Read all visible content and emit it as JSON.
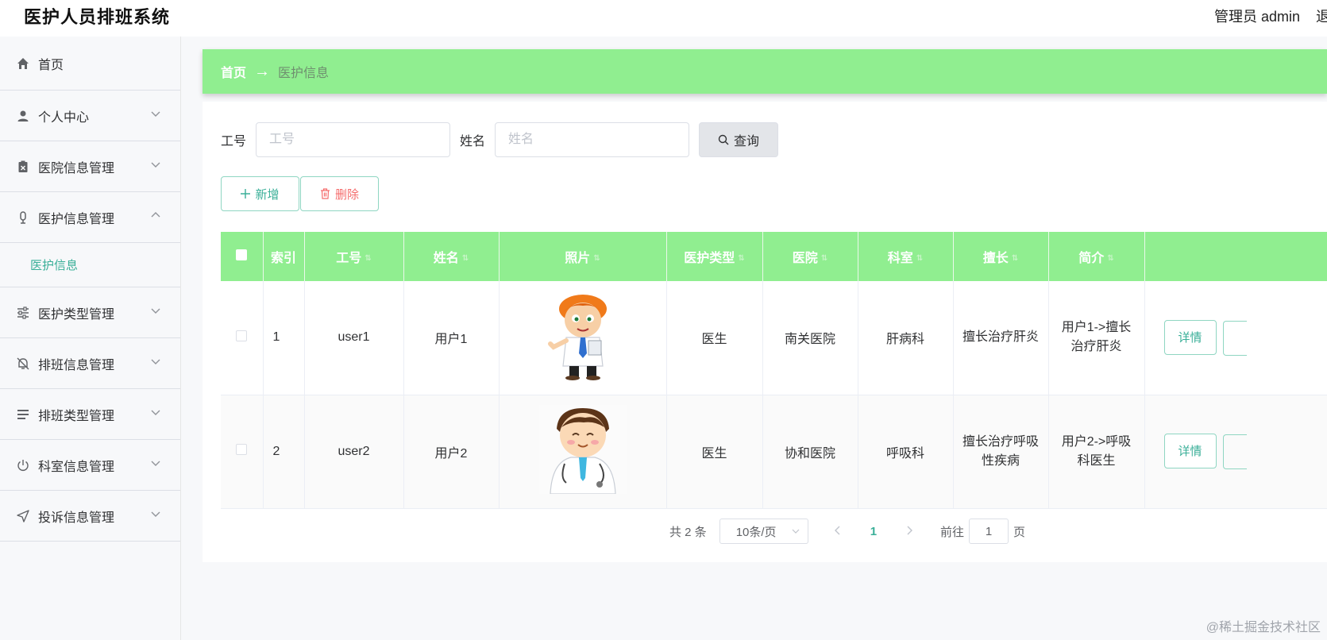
{
  "header": {
    "app_title": "医护人员排班系统",
    "user_label": "管理员 admin",
    "cut_off_text": "退"
  },
  "sidebar": {
    "items": [
      {
        "label": "首页",
        "icon": "home-icon"
      },
      {
        "label": "个人中心",
        "icon": "user-icon"
      },
      {
        "label": "医院信息管理",
        "icon": "clipboard-icon"
      },
      {
        "label": "医护信息管理",
        "icon": "microphone-icon"
      },
      {
        "label": "医护类型管理",
        "icon": "sliders-icon"
      },
      {
        "label": "排班信息管理",
        "icon": "bell-off-icon"
      },
      {
        "label": "排班类型管理",
        "icon": "list-icon"
      },
      {
        "label": "科室信息管理",
        "icon": "power-icon"
      },
      {
        "label": "投诉信息管理",
        "icon": "send-icon"
      }
    ],
    "sub_active": "医护信息"
  },
  "breadcrumb": {
    "home": "首页",
    "arrow": "→",
    "current": "医护信息"
  },
  "search": {
    "job_no_label": "工号",
    "job_no_placeholder": "工号",
    "job_no_value": "",
    "name_label": "姓名",
    "name_placeholder": "姓名",
    "name_value": "",
    "query_label": "查询"
  },
  "actions": {
    "add_label": "新增",
    "delete_label": "删除"
  },
  "table": {
    "headers": [
      "索引",
      "工号",
      "姓名",
      "照片",
      "医护类型",
      "医院",
      "科室",
      "擅长",
      "简介"
    ],
    "rows": [
      {
        "index": "1",
        "job_no": "user1",
        "name": "用户1",
        "type": "医生",
        "hospital": "南关医院",
        "dept": "肝病科",
        "specialty": "擅长治疗肝炎",
        "intro": "用户1->擅长治疗肝炎",
        "detail_label": "详情"
      },
      {
        "index": "2",
        "job_no": "user2",
        "name": "用户2",
        "type": "医生",
        "hospital": "协和医院",
        "dept": "呼吸科",
        "specialty": "擅长治疗呼吸性疾病",
        "intro": "用户2->呼吸科医生",
        "detail_label": "详情"
      }
    ]
  },
  "pagination": {
    "total_text": "共 2 条",
    "page_size": "10条/页",
    "current_page": "1",
    "goto_label": "前往",
    "goto_value": "1",
    "page_suffix": "页"
  },
  "watermark": "@稀土掘金技术社区",
  "colors": {
    "accent_green": "#90ee90",
    "teal": "#3aaf98",
    "danger": "#f56c6c"
  }
}
